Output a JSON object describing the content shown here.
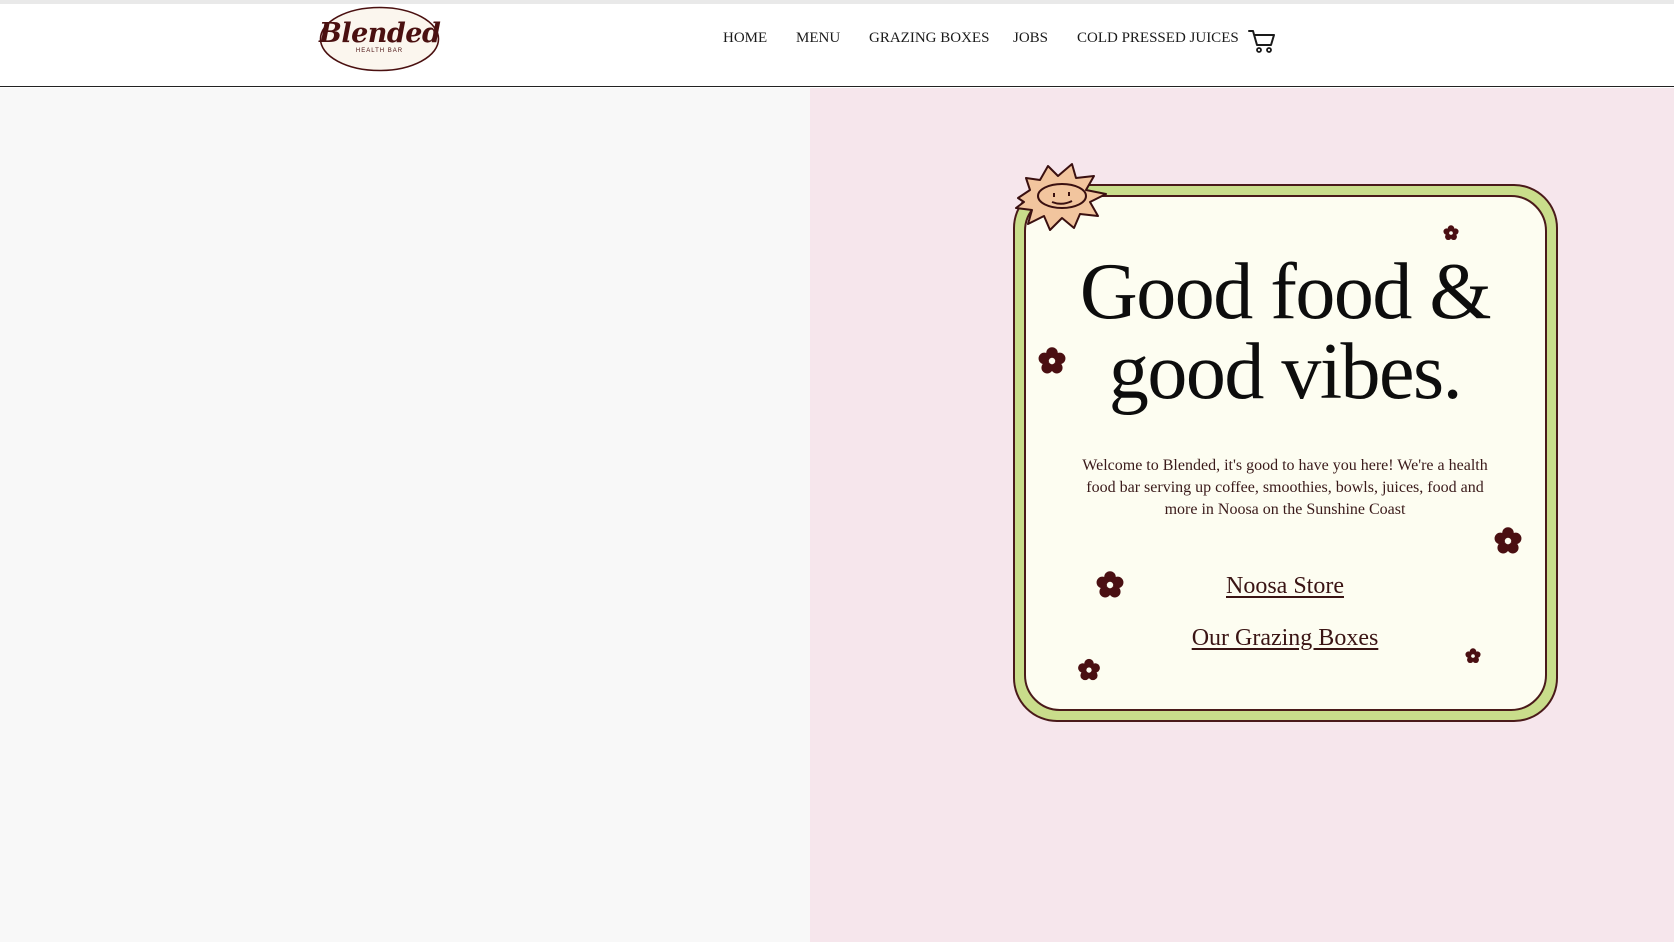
{
  "brand": {
    "logo_text": "Blended",
    "logo_sub": "HEALTH BAR"
  },
  "nav": {
    "items": [
      {
        "label": "HOME"
      },
      {
        "label": "MENU"
      },
      {
        "label": "GRAZING BOXES"
      },
      {
        "label": "JOBS"
      },
      {
        "label": "COLD PRESSED JUICES"
      }
    ],
    "cart_icon": "cart-icon"
  },
  "hero": {
    "headline_line1": "Good food &",
    "headline_line2": "good vibes.",
    "intro": "Welcome to Blended, it's good to have you here! We're a health food bar serving up coffee, smoothies, bowls, juices, food and more in Noosa on the Sunshine Coast",
    "links": [
      {
        "label": "Noosa Store"
      },
      {
        "label": "Our Grazing Boxes"
      }
    ]
  },
  "colors": {
    "left_panel": "#f8f8f8",
    "right_panel": "#f6e6ec",
    "card_border": "#c9dd8b",
    "card_bg": "#fdfdf1",
    "accent_dark": "#4a1a1a",
    "sun": "#f2c59e"
  },
  "icons": [
    "cart-icon",
    "sun-face-icon",
    "flower-icon"
  ]
}
